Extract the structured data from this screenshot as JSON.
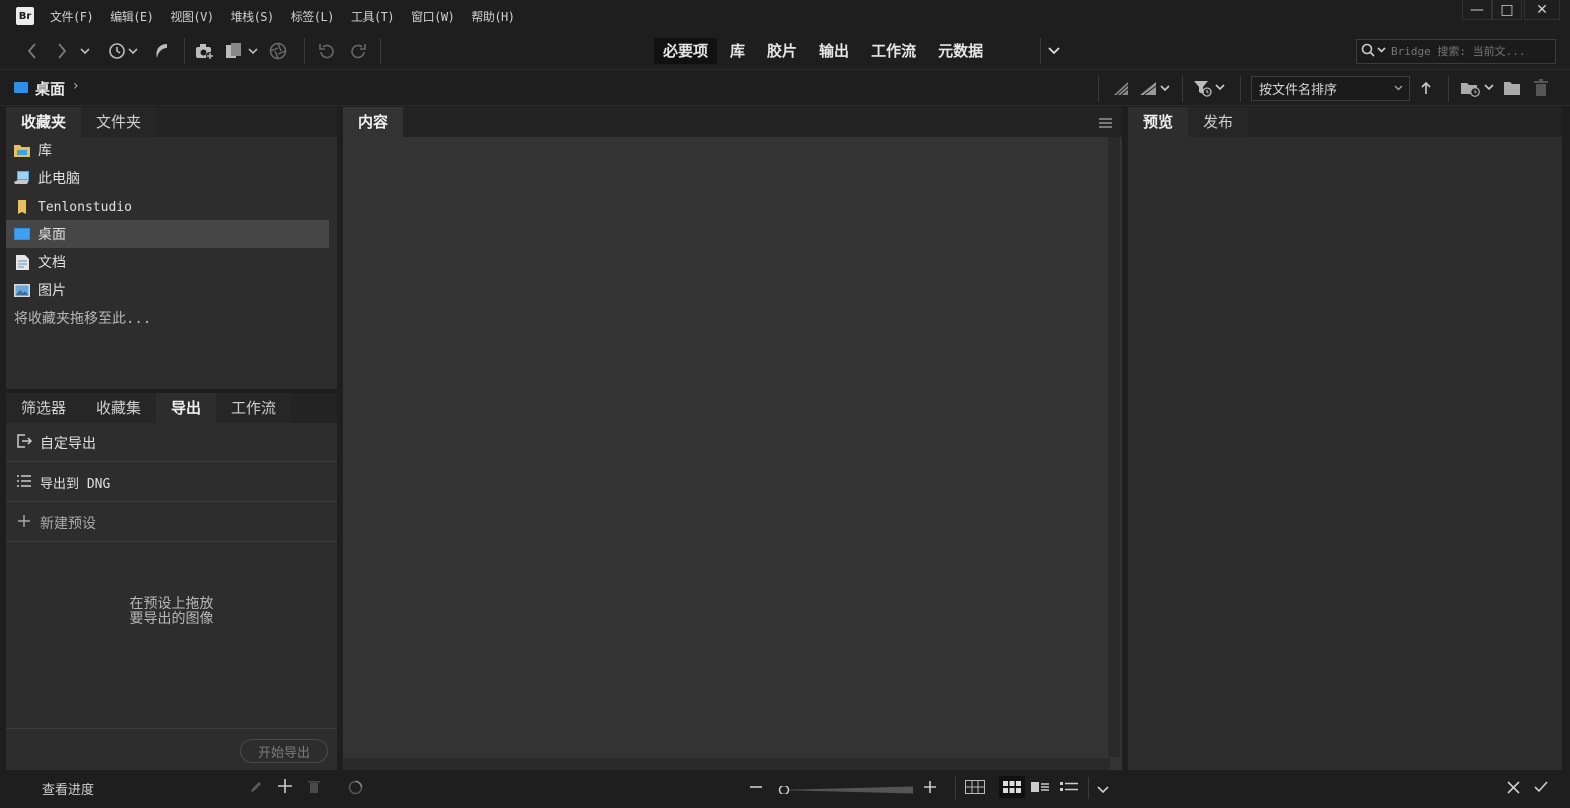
{
  "app": {
    "logo": "Br",
    "menu": [
      "文件(F)",
      "编辑(E)",
      "视图(V)",
      "堆栈(S)",
      "标签(L)",
      "工具(T)",
      "窗口(W)",
      "帮助(H)"
    ],
    "window_controls": {
      "minimize": "—",
      "maximize": "□",
      "close": "✕"
    }
  },
  "toolbar": {
    "workspaces": [
      {
        "label": "必要项",
        "active": true
      },
      {
        "label": "库",
        "active": false
      },
      {
        "label": "胶片",
        "active": false
      },
      {
        "label": "输出",
        "active": false
      },
      {
        "label": "工作流",
        "active": false
      },
      {
        "label": "元数据",
        "active": false
      }
    ],
    "search_placeholder": "Bridge 搜索: 当前文..."
  },
  "pathbar": {
    "current": "桌面",
    "sort_label": "按文件名排序"
  },
  "favorites_panel": {
    "tabs": [
      "收藏夹",
      "文件夹"
    ],
    "items": [
      {
        "label": "库",
        "icon": "library-icon"
      },
      {
        "label": "此电脑",
        "icon": "computer-icon"
      },
      {
        "label": "Tenlonstudio",
        "icon": "folder-icon"
      },
      {
        "label": "桌面",
        "icon": "desktop-icon"
      },
      {
        "label": "文档",
        "icon": "document-icon"
      },
      {
        "label": "图片",
        "icon": "pictures-icon"
      }
    ],
    "selected_index": 3,
    "drop_hint": "将收藏夹拖移至此..."
  },
  "export_panel": {
    "tabs": [
      "筛选器",
      "收藏集",
      "导出",
      "工作流"
    ],
    "active_tab": "导出",
    "items": [
      {
        "label": "自定导出",
        "icon": "export-icon"
      },
      {
        "label": "导出到 DNG",
        "icon": "list-icon"
      },
      {
        "label": "新建预设",
        "icon": "plus-icon"
      }
    ],
    "drop_hint_line1": "在预设上拖放",
    "drop_hint_line2": "要导出的图像",
    "start_button": "开始导出",
    "progress_link": "查看进度"
  },
  "content_panel": {
    "tab": "内容"
  },
  "preview_panel": {
    "tabs": [
      "预览",
      "发布"
    ]
  },
  "colors": {
    "accent_blue": "#2f8ee5",
    "folder_yellow": "#e8c15a",
    "panel_bg": "#2d2d2d",
    "chrome_bg": "#1e1e1e"
  }
}
